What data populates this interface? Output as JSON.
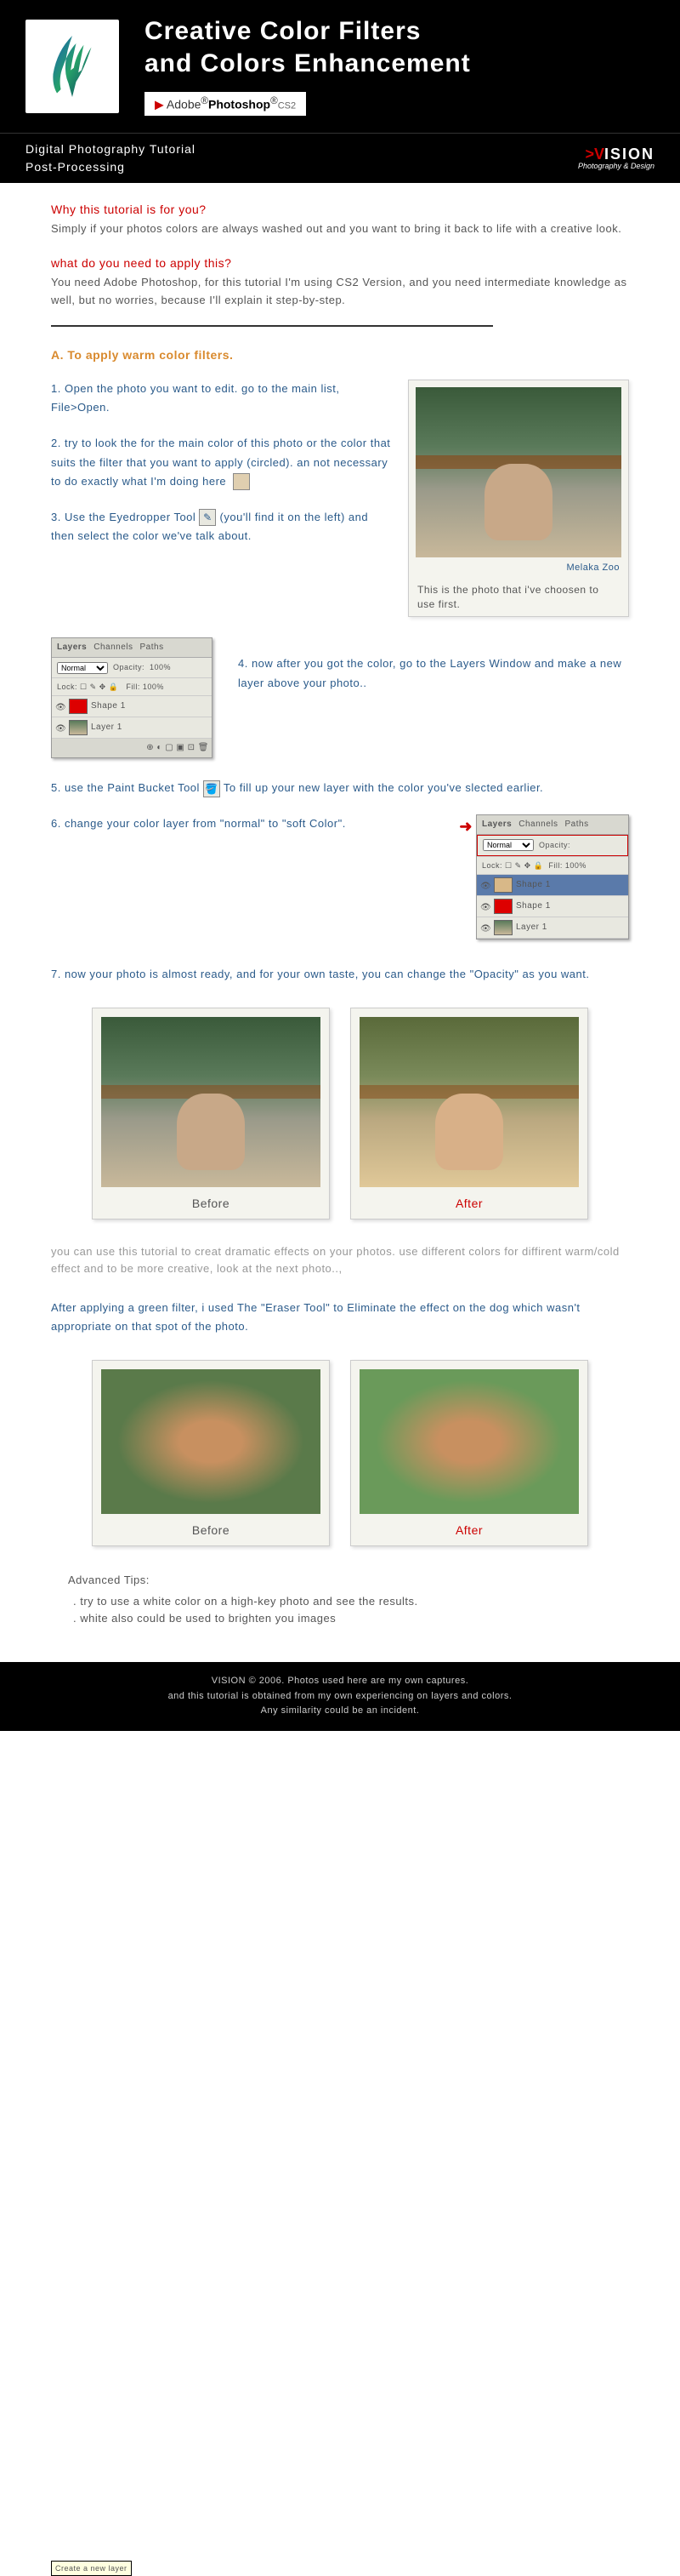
{
  "header": {
    "title_line1": "Creative Color Filters",
    "title_line2": "and Colors Enhancement",
    "adobe_prefix": "Adobe",
    "adobe_product": "Photoshop",
    "adobe_version": "CS2"
  },
  "subheader": {
    "line1": "Digital Photography Tutorial",
    "line2": "Post-Processing",
    "logo_name": "VISION",
    "logo_tag": "Photography & Design"
  },
  "intro": {
    "q1": "Why this tutorial is for you?",
    "a1": "Simply if your photos colors are always washed out and you want to bring it back to life with a creative look.",
    "q2": "what do you need to apply this?",
    "a2": "You need Adobe Photoshop, for this tutorial I'm using CS2 Version, and you need intermediate knowledge as well, but no worries,  because I'll explain it step-by-step."
  },
  "sectionA": {
    "title": "A. To apply warm color filters.",
    "step1": "1. Open the photo you want to edit. go to the main list, File>Open.",
    "step2": "2. try to look the for the main color of this photo or the color that suits the filter that you want to apply (circled). an not necessary to  do exactly what I'm doing here",
    "step3a": "3. Use the Eyedropper Tool ",
    "step3b": " (you'll find it on the left) and then select the color we've talk about.",
    "photo1_location": "Melaka Zoo",
    "photo1_caption": "This is the photo that i've choosen to use first.",
    "step4": "4. now after you got the color, go to the Layers Window and make a new layer above your photo..",
    "step5a": "5. use the Paint Bucket Tool ",
    "step5b": " To fill up your new layer with the color you've slected earlier.",
    "step6": "6. change your color layer from \"normal\" to \"soft Color\".",
    "step7": "7. now your photo is almost ready, and for your own taste, you can change the \"Opacity\" as you want."
  },
  "layers": {
    "tab1": "Layers",
    "tab2": "Channels",
    "tab3": "Paths",
    "mode_normal": "Normal",
    "opacity_label": "Opacity:",
    "opacity_val": "100%",
    "lock_label": "Lock:",
    "fill_label": "Fill:",
    "fill_val": "100%",
    "layer_shape": "Shape 1",
    "layer_bg": "Layer 1",
    "tooltip": "Create a new layer"
  },
  "compare": {
    "before": "Before",
    "after": "After"
  },
  "mid_text": {
    "gray": "you can use this tutorial to creat dramatic effects on your photos. use different colors for diffirent warm/cold effect and to be more creative, look at the next photo..,",
    "blue": "After applying a green filter, i used The \"Eraser Tool\" to Eliminate the effect on the dog which wasn't appropriate on that spot of the photo."
  },
  "advanced": {
    "title": "Advanced Tips:",
    "tip1": ". try to use a white color on a high-key photo and see the results.",
    "tip2": ". white also could be used to brighten you images"
  },
  "footer": {
    "line1": "VISION © 2006. Photos used here are my own captures.",
    "line2": "and this tutorial is obtained from my own experiencing on layers and colors.",
    "line3": "Any similarity could be an incident."
  }
}
